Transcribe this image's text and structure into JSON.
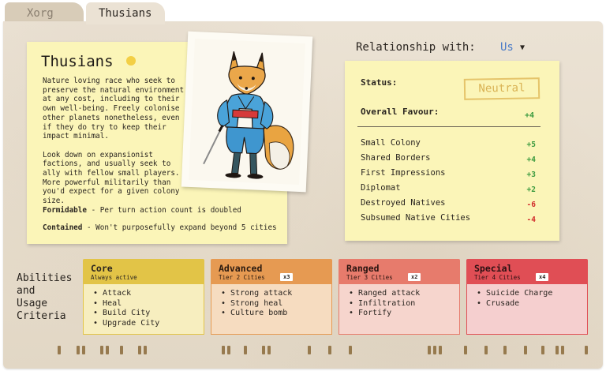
{
  "tabs": [
    {
      "label": "Xorg",
      "active": false
    },
    {
      "label": "Thusians",
      "active": true
    }
  ],
  "race": {
    "name": "Thusians",
    "color": "#f3cf45",
    "description": "Nature loving race who seek to\npreserve the natural environment\nat any cost, including to their\nown well-being. Freely colonise\nother planets nonetheless, even\nif they do try to keep their\nimpact minimal.\n\nLook down on expansionist\nfactions, and usually seek to\nally with fellow small players.\nMore powerful militarily than\nyou'd expect for a given colony\nsize.",
    "traits": [
      {
        "name": "Formidable",
        "text": " - Per turn action count is doubled"
      },
      {
        "name": "Contained",
        "text": " - Won't purposefully expand beyond 5 cities"
      }
    ]
  },
  "relationship": {
    "label": "Relationship with:",
    "selected": "Us",
    "status_label": "Status:",
    "status_value": "Neutral",
    "favour_label": "Overall Favour:",
    "favour_value": "+4",
    "modifiers": [
      {
        "name": "Small Colony",
        "value": "+5",
        "positive": true
      },
      {
        "name": "Shared Borders",
        "value": "+4",
        "positive": true
      },
      {
        "name": "First Impressions",
        "value": "+3",
        "positive": true
      },
      {
        "name": "Diplomat",
        "value": "+2",
        "positive": true
      },
      {
        "name": "Destroyed Natives",
        "value": "-6",
        "positive": false
      },
      {
        "name": "Subsumed Native Cities",
        "value": "-4",
        "positive": false
      }
    ]
  },
  "abilities": {
    "label": "Abilities\nand\nUsage\nCriteria",
    "tiers": [
      {
        "title": "Core",
        "subtitle": "Always active",
        "badge": "",
        "items": [
          "Attack",
          "Heal",
          "Build City",
          "Upgrade City"
        ]
      },
      {
        "title": "Advanced",
        "subtitle": "Tier 2 Cities",
        "badge": "x3",
        "items": [
          "Strong attack",
          "Strong heal",
          "Culture bomb"
        ]
      },
      {
        "title": "Ranged",
        "subtitle": "Tier 3 Cities",
        "badge": "x2",
        "items": [
          "Ranged attack",
          "Infiltration",
          "Fortify"
        ]
      },
      {
        "title": "Special",
        "subtitle": "Tier 4 Cities",
        "badge": "x4",
        "items": [
          "Suicide Charge",
          "Crusade"
        ]
      }
    ]
  },
  "colors": {
    "positive": "#3a9a3e",
    "negative": "#d12b2b",
    "accent_link": "#4a7bc8"
  }
}
